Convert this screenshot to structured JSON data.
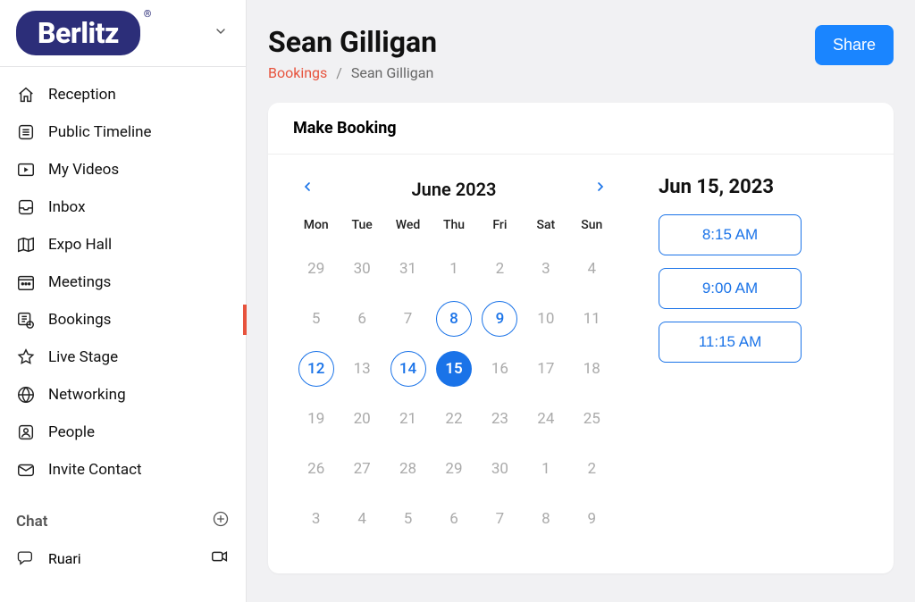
{
  "brand": "Berlitz",
  "header": {
    "title": "Sean Gilligan",
    "share_label": "Share"
  },
  "breadcrumb": {
    "root": "Bookings",
    "current": "Sean Gilligan"
  },
  "sidebar": {
    "items": [
      {
        "label": "Reception",
        "icon": "home"
      },
      {
        "label": "Public Timeline",
        "icon": "list"
      },
      {
        "label": "My Videos",
        "icon": "video"
      },
      {
        "label": "Inbox",
        "icon": "tray"
      },
      {
        "label": "Expo Hall",
        "icon": "map"
      },
      {
        "label": "Meetings",
        "icon": "cal-dots"
      },
      {
        "label": "Bookings",
        "icon": "bookings",
        "active": true
      },
      {
        "label": "Live Stage",
        "icon": "star"
      },
      {
        "label": "Networking",
        "icon": "globe"
      },
      {
        "label": "People",
        "icon": "person"
      },
      {
        "label": "Invite Contact",
        "icon": "mail"
      }
    ]
  },
  "chat": {
    "header": "Chat",
    "contacts": [
      {
        "name": "Ruari"
      }
    ]
  },
  "booking": {
    "card_title": "Make Booking",
    "month_label": "June 2023",
    "dow": [
      "Mon",
      "Tue",
      "Wed",
      "Thu",
      "Fri",
      "Sat",
      "Sun"
    ],
    "weeks": [
      [
        {
          "n": 29,
          "dim": true
        },
        {
          "n": 30,
          "dim": true
        },
        {
          "n": 31,
          "dim": true
        },
        {
          "n": 1
        },
        {
          "n": 2
        },
        {
          "n": 3
        },
        {
          "n": 4
        }
      ],
      [
        {
          "n": 5
        },
        {
          "n": 6
        },
        {
          "n": 7
        },
        {
          "n": 8,
          "available": true
        },
        {
          "n": 9,
          "available": true
        },
        {
          "n": 10
        },
        {
          "n": 11
        }
      ],
      [
        {
          "n": 12,
          "available": true
        },
        {
          "n": 13
        },
        {
          "n": 14,
          "available": true
        },
        {
          "n": 15,
          "selected": true
        },
        {
          "n": 16
        },
        {
          "n": 17
        },
        {
          "n": 18
        }
      ],
      [
        {
          "n": 19
        },
        {
          "n": 20
        },
        {
          "n": 21
        },
        {
          "n": 22
        },
        {
          "n": 23
        },
        {
          "n": 24
        },
        {
          "n": 25
        }
      ],
      [
        {
          "n": 26
        },
        {
          "n": 27
        },
        {
          "n": 28
        },
        {
          "n": 29
        },
        {
          "n": 30
        },
        {
          "n": 1,
          "dim": true
        },
        {
          "n": 2,
          "dim": true
        }
      ],
      [
        {
          "n": 3,
          "dim": true
        },
        {
          "n": 4,
          "dim": true
        },
        {
          "n": 5,
          "dim": true
        },
        {
          "n": 6,
          "dim": true
        },
        {
          "n": 7,
          "dim": true
        },
        {
          "n": 8,
          "dim": true
        },
        {
          "n": 9,
          "dim": true
        }
      ]
    ],
    "selected_date": "Jun 15, 2023",
    "slots": [
      "8:15 AM",
      "9:00 AM",
      "11:15 AM"
    ]
  }
}
